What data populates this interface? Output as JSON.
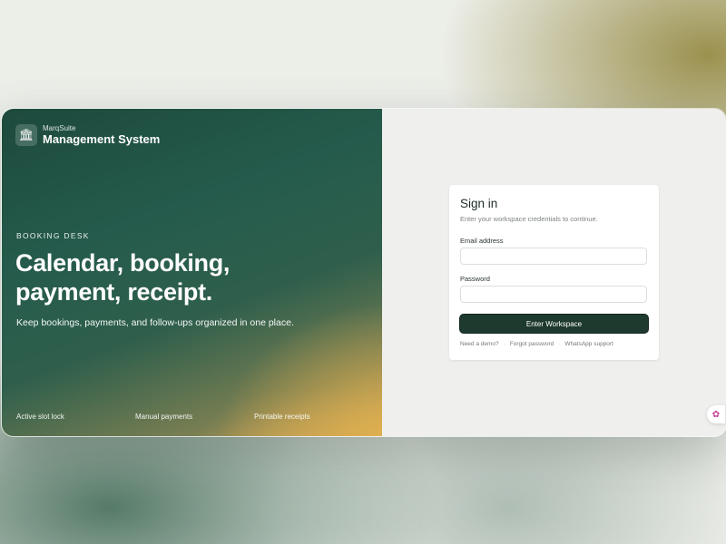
{
  "brand": {
    "small": "MarqSuite",
    "title": "Management System",
    "icon": "bank-icon"
  },
  "hero": {
    "eyebrow": "BOOKING DESK",
    "headline_line1": "Calendar, booking,",
    "headline_line2": "payment, receipt.",
    "lead": "Keep bookings, payments, and follow-ups organized in one place.",
    "features": [
      "Active slot lock",
      "Manual payments",
      "Printable receipts"
    ]
  },
  "signin": {
    "title": "Sign in",
    "subtitle": "Enter your workspace credentials to continue.",
    "email_label": "Email address",
    "email_value": "",
    "password_label": "Password",
    "password_value": "",
    "submit_label": "Enter Workspace",
    "links": [
      "Need a demo?",
      "Forgot password",
      "WhatsApp support"
    ]
  },
  "floating_widget": {
    "icon": "brain-icon"
  },
  "colors": {
    "primary_button": "#1e3a2f",
    "hero_green": "#255b4c",
    "hero_gold": "#e2b04e"
  }
}
